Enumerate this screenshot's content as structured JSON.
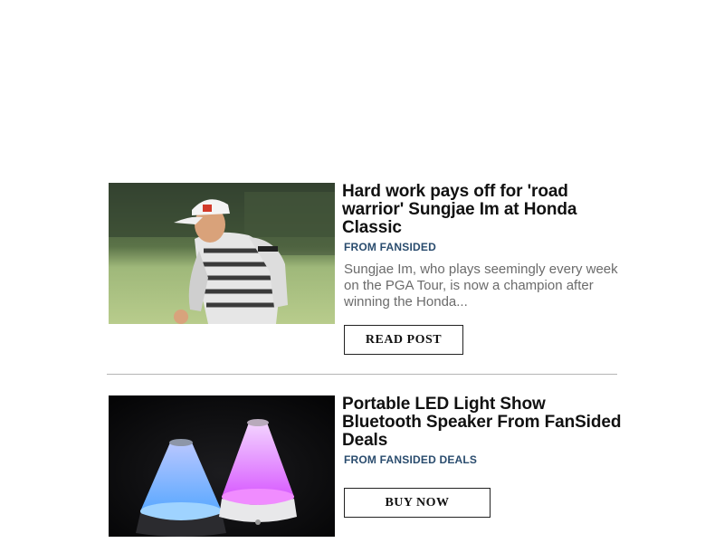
{
  "feed": {
    "items": [
      {
        "headline": "Hard work pays off for 'road warrior' Sungjae Im at Honda Classic",
        "source": "FROM FANSIDED",
        "excerpt": "Sungjae Im, who plays seemingly every week on the PGA Tour, is now a champion after winning the Honda...",
        "cta": "READ POST",
        "image_icon": "golfer-photo"
      },
      {
        "headline": "Portable LED Light Show Bluetooth Speaker From FanSided Deals",
        "source": "FROM FANSIDED DEALS",
        "cta": "BUY NOW",
        "image_icon": "speaker-photo"
      }
    ]
  }
}
